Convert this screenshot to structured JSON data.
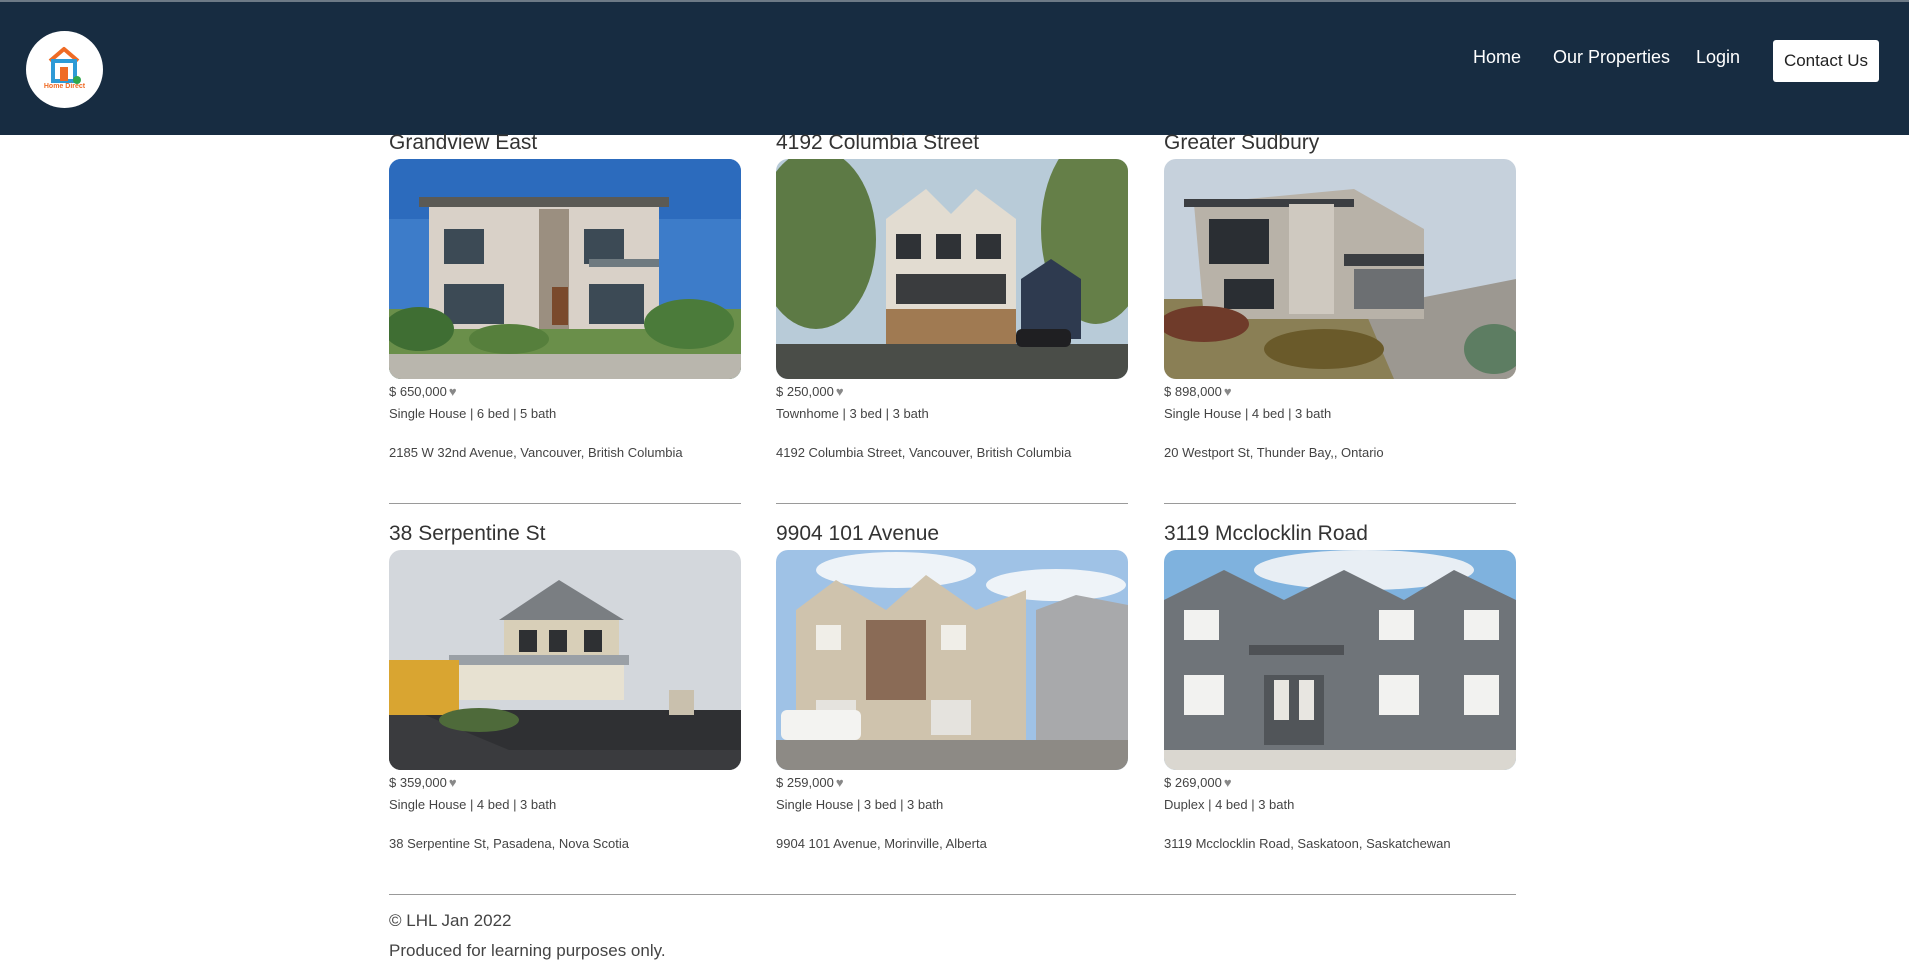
{
  "brand": {
    "logo_text": "Home Direct",
    "colors": {
      "header_bg": "#172c41",
      "logo_orange": "#ef6b25",
      "logo_blue": "#2e9ad6",
      "logo_green": "#2fa84f"
    }
  },
  "nav": {
    "home": "Home",
    "properties": "Our Properties",
    "login": "Login",
    "contact": "Contact Us"
  },
  "heart_icon": "♥",
  "listings": [
    {
      "title": "Grandview East",
      "price": "$ 650,000",
      "details": "Single House | 6 bed | 5 bath",
      "address": "2185 W 32nd Avenue, Vancouver, British Columbia",
      "photo": "modern-stucco-house"
    },
    {
      "title": "4192 Columbia Street",
      "price": "$ 250,000",
      "details": "Townhome | 3 bed | 3 bath",
      "address": "4192 Columbia Street, Vancouver, British Columbia",
      "photo": "modern-townhome"
    },
    {
      "title": "Greater Sudbury",
      "price": "$ 898,000",
      "details": "Single House | 4 bed | 3 bath",
      "address": "20 Westport St, Thunder Bay,, Ontario",
      "photo": "modern-stone-house"
    },
    {
      "title": "38 Serpentine St",
      "price": "$ 359,000",
      "details": "Single House | 4 bed | 3 bath",
      "address": "38 Serpentine St, Pasadena, Nova Scotia",
      "photo": "two-storey-siding-house"
    },
    {
      "title": "9904 101 Avenue",
      "price": "$ 259,000",
      "details": "Single House | 3 bed | 3 bath",
      "address": "9904 101 Avenue, Morinville, Alberta",
      "photo": "row-townhouses"
    },
    {
      "title": "3119 Mcclocklin Road",
      "price": "$ 269,000",
      "details": "Duplex | 4 bed | 3 bath",
      "address": "3119 Mcclocklin Road, Saskatoon, Saskatchewan",
      "photo": "grey-duplex"
    }
  ],
  "footer": {
    "copyright": "© LHL Jan 2022",
    "note": "Produced for learning purposes only."
  }
}
